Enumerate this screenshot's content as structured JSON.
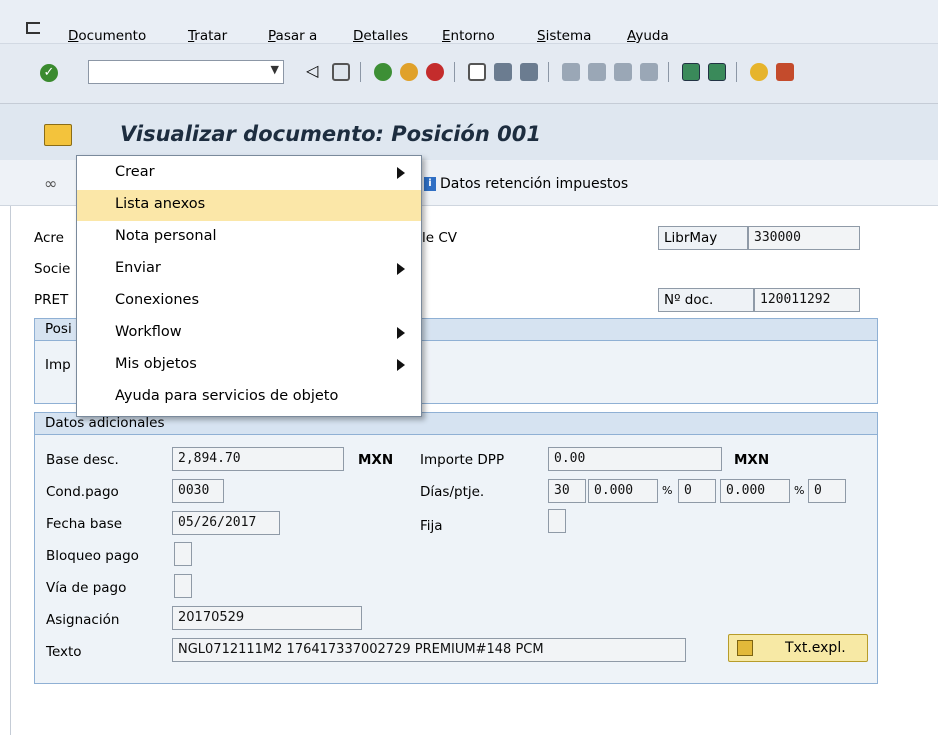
{
  "menu": [
    "Documento",
    "Tratar",
    "Pasar a",
    "Detalles",
    "Entorno",
    "Sistema",
    "Ayuda"
  ],
  "toolbar": {
    "command_value": "",
    "icons": [
      "back-arrow-icon",
      "save-icon",
      "back-icon",
      "exit-icon",
      "cancel-icon",
      "print-icon",
      "find-icon",
      "find-next-icon",
      "first-page-icon",
      "previous-page-icon",
      "next-page-icon",
      "last-page-icon",
      "create-session-icon",
      "shortcut-icon",
      "help-icon",
      "customize-layout-icon"
    ]
  },
  "title": "Visualizar documento: Posición 001",
  "apptoolbar": {
    "retention_label": "Datos retención impuestos",
    "retention_icon": "i"
  },
  "header": {
    "acreedor_label": "Acre",
    "acreedor_text": "le CV",
    "libmay_label": "LibrMay",
    "libmay_value": "330000",
    "sociedad_label": "Socie",
    "pret_label": "PRET",
    "ndoc_label": "Nº doc.",
    "ndoc_value": "120011292"
  },
  "posicion_group": {
    "title": "Posi",
    "importe_label": "Imp"
  },
  "context_menu": {
    "items": [
      {
        "label": "Crear",
        "submenu": true
      },
      {
        "label": "Lista anexos",
        "submenu": false
      },
      {
        "label": "Nota personal",
        "submenu": false
      },
      {
        "label": "Enviar",
        "submenu": true
      },
      {
        "label": "Conexiones",
        "submenu": false
      },
      {
        "label": "Workflow",
        "submenu": true
      },
      {
        "label": "Mis objetos",
        "submenu": true
      },
      {
        "label": "Ayuda para servicios de objeto",
        "submenu": false
      }
    ]
  },
  "datos_adicionales": {
    "title": "Datos adicionales",
    "base_desc_label": "Base desc.",
    "base_desc_value": "2,894.70",
    "currency1": "MXN",
    "importe_dpp_label": "Importe DPP",
    "importe_dpp_value": "0.00",
    "currency2": "MXN",
    "cond_pago_label": "Cond.pago",
    "cond_pago_value": "0030",
    "dias_label": "Días/ptje.",
    "dias1": "30",
    "pct1": "0.000",
    "pct_sym1": "%",
    "dias2": "0",
    "pct2": "0.000",
    "pct_sym2": "%",
    "dias3": "0",
    "fecha_base_label": "Fecha base",
    "fecha_base_value": "05/26/2017",
    "fija_label": "Fija",
    "bloqueo_label": "Bloqueo pago",
    "via_pago_label": "Vía de pago",
    "asignacion_label": "Asignación",
    "asignacion_value": "20170529",
    "texto_label": "Texto",
    "texto_value": "NGL0712111M2 176417337002729 PREMIUM#148 PCM",
    "txt_expl_label": "Txt.expl."
  },
  "colors": {
    "highlight": "#fbe7a8",
    "group_border": "#8fb0d4"
  }
}
